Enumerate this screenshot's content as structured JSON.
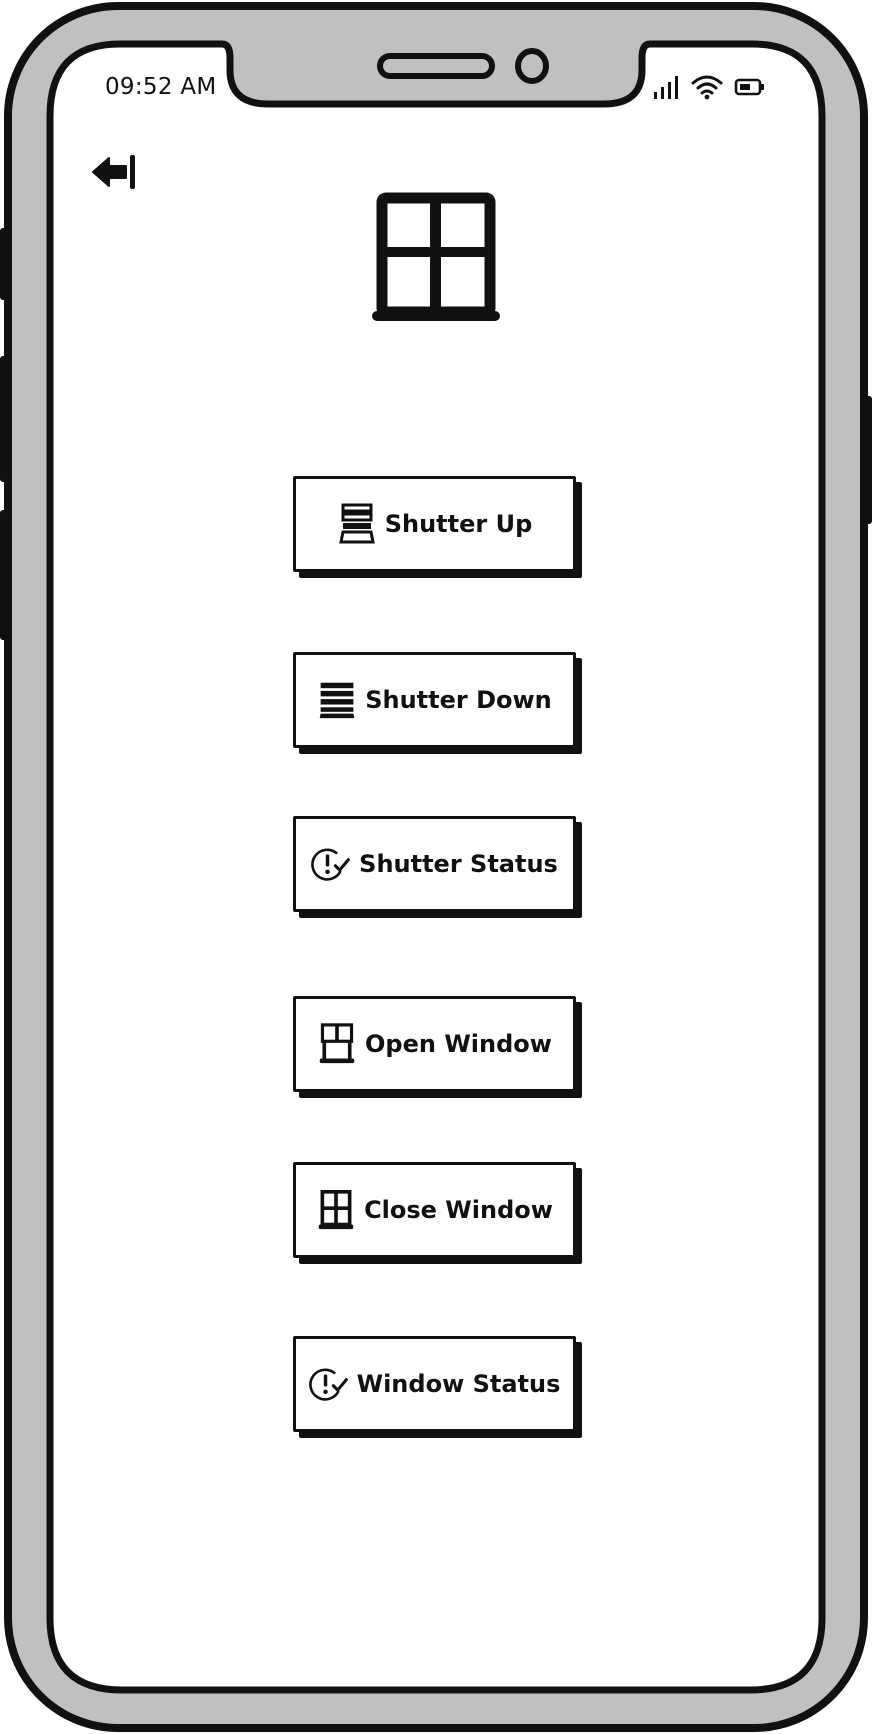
{
  "status_bar": {
    "time": "09:52 AM",
    "icons": [
      "signal-icon",
      "wifi-icon",
      "battery-icon"
    ]
  },
  "nav": {
    "back_icon": "exit-arrow-icon"
  },
  "hero": {
    "icon": "window-icon"
  },
  "buttons": [
    {
      "id": "shutter-up",
      "label": "Shutter Up",
      "icon": "shutter-up-icon"
    },
    {
      "id": "shutter-down",
      "label": "Shutter Down",
      "icon": "shutter-down-icon"
    },
    {
      "id": "shutter-status",
      "label": "Shutter Status",
      "icon": "status-check-icon"
    },
    {
      "id": "open-window",
      "label": "Open Window",
      "icon": "open-window-icon"
    },
    {
      "id": "close-window",
      "label": "Close Window",
      "icon": "close-window-icon"
    },
    {
      "id": "window-status",
      "label": "Window Status",
      "icon": "status-check-icon"
    }
  ],
  "colors": {
    "frame": "#c0c0c0",
    "ink": "#111111",
    "screen": "#ffffff"
  }
}
